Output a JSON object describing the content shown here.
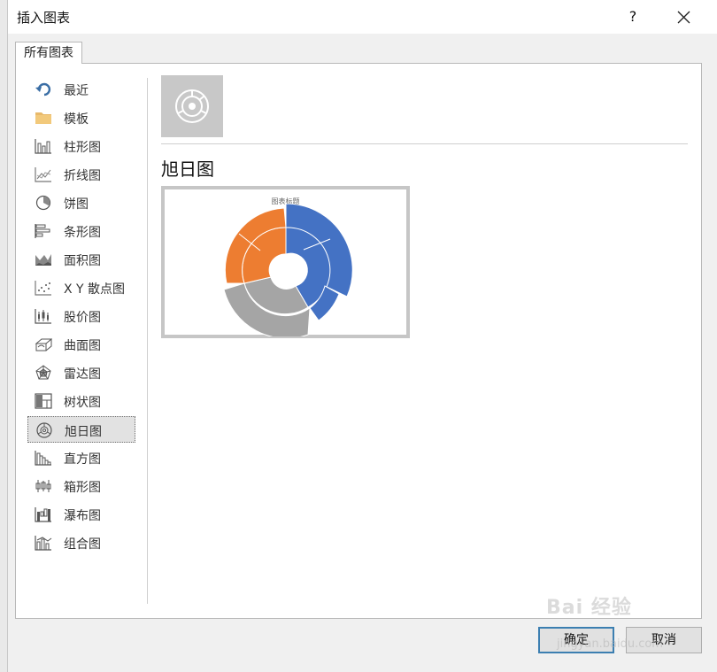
{
  "window": {
    "title": "插入图表",
    "help": "?",
    "close_icon": "close-icon"
  },
  "tabs": [
    {
      "label": "所有图表"
    }
  ],
  "sidebar": {
    "items": [
      {
        "label": "最近",
        "icon": "recent-undo-icon"
      },
      {
        "label": "模板",
        "icon": "folder-icon"
      },
      {
        "label": "柱形图",
        "icon": "column-chart-icon"
      },
      {
        "label": "折线图",
        "icon": "line-chart-icon"
      },
      {
        "label": "饼图",
        "icon": "pie-chart-icon"
      },
      {
        "label": "条形图",
        "icon": "bar-chart-icon"
      },
      {
        "label": "面积图",
        "icon": "area-chart-icon"
      },
      {
        "label": "X Y 散点图",
        "icon": "scatter-chart-icon"
      },
      {
        "label": "股价图",
        "icon": "stock-chart-icon"
      },
      {
        "label": "曲面图",
        "icon": "surface-chart-icon"
      },
      {
        "label": "雷达图",
        "icon": "radar-chart-icon"
      },
      {
        "label": "树状图",
        "icon": "treemap-chart-icon"
      },
      {
        "label": "旭日图",
        "icon": "sunburst-chart-icon",
        "selected": true
      },
      {
        "label": "直方图",
        "icon": "histogram-chart-icon"
      },
      {
        "label": "箱形图",
        "icon": "box-whisker-chart-icon"
      },
      {
        "label": "瀑布图",
        "icon": "waterfall-chart-icon"
      },
      {
        "label": "组合图",
        "icon": "combo-chart-icon"
      }
    ]
  },
  "main": {
    "chart_type_name": "旭日图",
    "preview_title": "图表标题"
  },
  "buttons": {
    "ok": "确定",
    "cancel": "取消"
  },
  "watermark": {
    "line1": "Bai 经验",
    "line2": "jingyan.baidu.com"
  },
  "colors": {
    "accent": "#3c7fb1",
    "blue": "#4472c4",
    "orange": "#ed7d31",
    "gray": "#a5a5a5"
  }
}
